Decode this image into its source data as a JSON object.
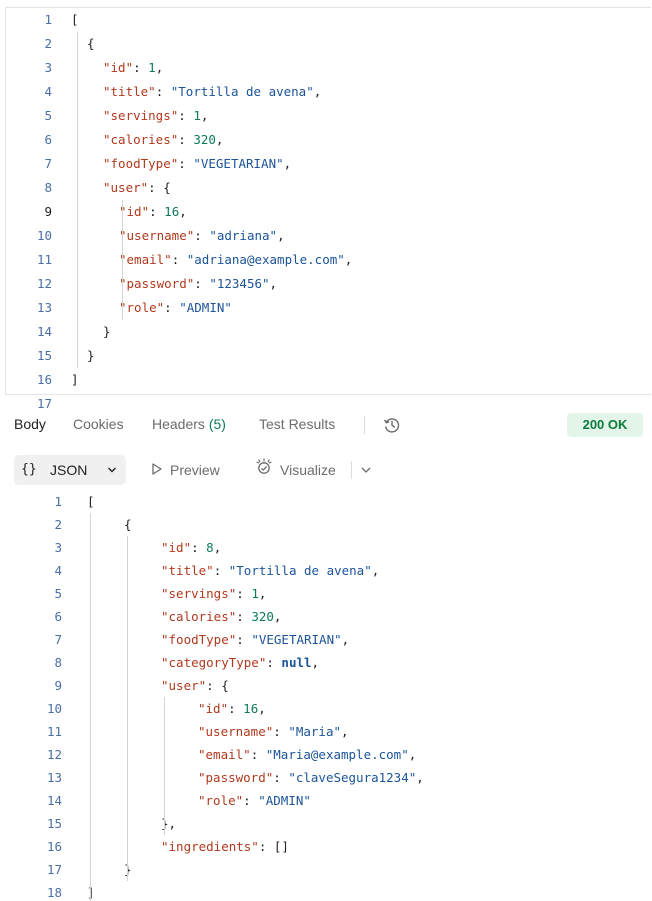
{
  "request_body": {
    "lines": [
      {
        "n": "1",
        "indent": 0,
        "tokens": [
          {
            "t": "[",
            "c": "p"
          }
        ]
      },
      {
        "n": "2",
        "indent": 1,
        "tokens": [
          {
            "t": "{",
            "c": "p"
          }
        ]
      },
      {
        "n": "3",
        "indent": 2,
        "tokens": [
          {
            "t": "\"id\"",
            "c": "k"
          },
          {
            "t": ": ",
            "c": "p"
          },
          {
            "t": "1",
            "c": "n"
          },
          {
            "t": ",",
            "c": "p"
          }
        ]
      },
      {
        "n": "4",
        "indent": 2,
        "tokens": [
          {
            "t": "\"title\"",
            "c": "k"
          },
          {
            "t": ": ",
            "c": "p"
          },
          {
            "t": "\"Tortilla de avena\"",
            "c": "s"
          },
          {
            "t": ",",
            "c": "p"
          }
        ]
      },
      {
        "n": "5",
        "indent": 2,
        "tokens": [
          {
            "t": "\"servings\"",
            "c": "k"
          },
          {
            "t": ": ",
            "c": "p"
          },
          {
            "t": "1",
            "c": "n"
          },
          {
            "t": ",",
            "c": "p"
          }
        ]
      },
      {
        "n": "6",
        "indent": 2,
        "tokens": [
          {
            "t": "\"calories\"",
            "c": "k"
          },
          {
            "t": ": ",
            "c": "p"
          },
          {
            "t": "320",
            "c": "n"
          },
          {
            "t": ",",
            "c": "p"
          }
        ]
      },
      {
        "n": "7",
        "indent": 2,
        "tokens": [
          {
            "t": "\"foodType\"",
            "c": "k"
          },
          {
            "t": ": ",
            "c": "p"
          },
          {
            "t": "\"VEGETARIAN\"",
            "c": "s"
          },
          {
            "t": ",",
            "c": "p"
          }
        ]
      },
      {
        "n": "8",
        "indent": 2,
        "tokens": [
          {
            "t": "\"user\"",
            "c": "k"
          },
          {
            "t": ": {",
            "c": "p"
          }
        ]
      },
      {
        "n": "9",
        "indent": 3,
        "active": true,
        "tokens": [
          {
            "t": "\"id\"",
            "c": "k"
          },
          {
            "t": ": ",
            "c": "p"
          },
          {
            "t": "16",
            "c": "n"
          },
          {
            "t": ",",
            "c": "p"
          }
        ]
      },
      {
        "n": "10",
        "indent": 3,
        "tokens": [
          {
            "t": "\"username\"",
            "c": "k"
          },
          {
            "t": ": ",
            "c": "p"
          },
          {
            "t": "\"adriana\"",
            "c": "s"
          },
          {
            "t": ",",
            "c": "p"
          }
        ]
      },
      {
        "n": "11",
        "indent": 3,
        "tokens": [
          {
            "t": "\"email\"",
            "c": "k"
          },
          {
            "t": ": ",
            "c": "p"
          },
          {
            "t": "\"adriana@example.com\"",
            "c": "s"
          },
          {
            "t": ",",
            "c": "p"
          }
        ]
      },
      {
        "n": "12",
        "indent": 3,
        "tokens": [
          {
            "t": "\"password\"",
            "c": "k"
          },
          {
            "t": ": ",
            "c": "p"
          },
          {
            "t": "\"123456\"",
            "c": "s"
          },
          {
            "t": ",",
            "c": "p"
          }
        ]
      },
      {
        "n": "13",
        "indent": 3,
        "tokens": [
          {
            "t": "\"role\"",
            "c": "k"
          },
          {
            "t": ": ",
            "c": "p"
          },
          {
            "t": "\"ADMIN\"",
            "c": "s"
          }
        ]
      },
      {
        "n": "14",
        "indent": 2,
        "tokens": [
          {
            "t": "}",
            "c": "p"
          }
        ]
      },
      {
        "n": "15",
        "indent": 1,
        "tokens": [
          {
            "t": "}",
            "c": "p"
          }
        ]
      },
      {
        "n": "16",
        "indent": 0,
        "tokens": [
          {
            "t": "]",
            "c": "p"
          }
        ]
      },
      {
        "n": "17",
        "indent": 0,
        "tokens": []
      }
    ]
  },
  "response_tabs": {
    "body": "Body",
    "cookies": "Cookies",
    "headers": "Headers",
    "headers_count": "(5)",
    "test_results": "Test Results",
    "history_icon": "history-icon",
    "status": "200 OK",
    "status_color": "#0c7a3d"
  },
  "toolbar": {
    "format_braces": "{}",
    "format": "JSON",
    "preview": "Preview",
    "visualize": "Visualize"
  },
  "response_body": {
    "lines": [
      {
        "n": "1",
        "indent": 0,
        "tokens": [
          {
            "t": "[",
            "c": "p"
          }
        ]
      },
      {
        "n": "2",
        "indent": 1,
        "tokens": [
          {
            "t": "{",
            "c": "p"
          }
        ]
      },
      {
        "n": "3",
        "indent": 2,
        "tokens": [
          {
            "t": "\"id\"",
            "c": "k"
          },
          {
            "t": ": ",
            "c": "p"
          },
          {
            "t": "8",
            "c": "n"
          },
          {
            "t": ",",
            "c": "p"
          }
        ]
      },
      {
        "n": "4",
        "indent": 2,
        "tokens": [
          {
            "t": "\"title\"",
            "c": "k"
          },
          {
            "t": ": ",
            "c": "p"
          },
          {
            "t": "\"Tortilla de avena\"",
            "c": "s"
          },
          {
            "t": ",",
            "c": "p"
          }
        ]
      },
      {
        "n": "5",
        "indent": 2,
        "tokens": [
          {
            "t": "\"servings\"",
            "c": "k"
          },
          {
            "t": ": ",
            "c": "p"
          },
          {
            "t": "1",
            "c": "n"
          },
          {
            "t": ",",
            "c": "p"
          }
        ]
      },
      {
        "n": "6",
        "indent": 2,
        "tokens": [
          {
            "t": "\"calories\"",
            "c": "k"
          },
          {
            "t": ": ",
            "c": "p"
          },
          {
            "t": "320",
            "c": "n"
          },
          {
            "t": ",",
            "c": "p"
          }
        ]
      },
      {
        "n": "7",
        "indent": 2,
        "tokens": [
          {
            "t": "\"foodType\"",
            "c": "k"
          },
          {
            "t": ": ",
            "c": "p"
          },
          {
            "t": "\"VEGETARIAN\"",
            "c": "s"
          },
          {
            "t": ",",
            "c": "p"
          }
        ]
      },
      {
        "n": "8",
        "indent": 2,
        "tokens": [
          {
            "t": "\"categoryType\"",
            "c": "k"
          },
          {
            "t": ": ",
            "c": "p"
          },
          {
            "t": "null",
            "c": "kw"
          },
          {
            "t": ",",
            "c": "p"
          }
        ]
      },
      {
        "n": "9",
        "indent": 2,
        "tokens": [
          {
            "t": "\"user\"",
            "c": "k"
          },
          {
            "t": ": {",
            "c": "p"
          }
        ]
      },
      {
        "n": "10",
        "indent": 3,
        "tokens": [
          {
            "t": "\"id\"",
            "c": "k"
          },
          {
            "t": ": ",
            "c": "p"
          },
          {
            "t": "16",
            "c": "n"
          },
          {
            "t": ",",
            "c": "p"
          }
        ]
      },
      {
        "n": "11",
        "indent": 3,
        "tokens": [
          {
            "t": "\"username\"",
            "c": "k"
          },
          {
            "t": ": ",
            "c": "p"
          },
          {
            "t": "\"Maria\"",
            "c": "s"
          },
          {
            "t": ",",
            "c": "p"
          }
        ]
      },
      {
        "n": "12",
        "indent": 3,
        "tokens": [
          {
            "t": "\"email\"",
            "c": "k"
          },
          {
            "t": ": ",
            "c": "p"
          },
          {
            "t": "\"Maria@example.com\"",
            "c": "s"
          },
          {
            "t": ",",
            "c": "p"
          }
        ]
      },
      {
        "n": "13",
        "indent": 3,
        "tokens": [
          {
            "t": "\"password\"",
            "c": "k"
          },
          {
            "t": ": ",
            "c": "p"
          },
          {
            "t": "\"claveSegura1234\"",
            "c": "s"
          },
          {
            "t": ",",
            "c": "p"
          }
        ]
      },
      {
        "n": "14",
        "indent": 3,
        "tokens": [
          {
            "t": "\"role\"",
            "c": "k"
          },
          {
            "t": ": ",
            "c": "p"
          },
          {
            "t": "\"ADMIN\"",
            "c": "s"
          }
        ]
      },
      {
        "n": "15",
        "indent": 2,
        "tokens": [
          {
            "t": "},",
            "c": "p"
          }
        ]
      },
      {
        "n": "16",
        "indent": 2,
        "tokens": [
          {
            "t": "\"ingredients\"",
            "c": "k"
          },
          {
            "t": ": []",
            "c": "p"
          }
        ]
      },
      {
        "n": "17",
        "indent": 1,
        "tokens": [
          {
            "t": "}",
            "c": "p"
          }
        ]
      },
      {
        "n": "18",
        "indent": 0,
        "tokens": [
          {
            "t": "]",
            "c": "p"
          }
        ]
      }
    ]
  }
}
